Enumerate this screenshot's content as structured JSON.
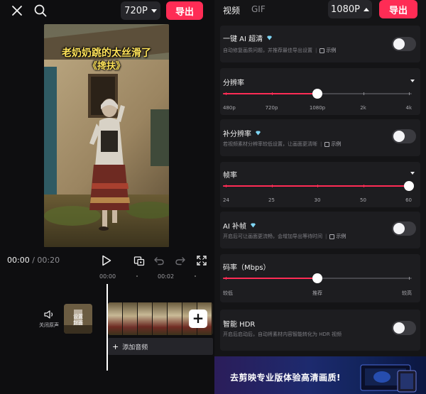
{
  "editor": {
    "resolution_pill": "720P",
    "export_label": "导出",
    "caption_line1": "老奶奶跳的太丝滑了",
    "caption_line2": "《搀扶》",
    "time_current": "00:00",
    "time_separator": " / ",
    "time_total": "00:20",
    "ruler_labels": [
      "00:00",
      "00:02"
    ],
    "track_mute_label": "关闭原声",
    "cover_label_line1": "设置",
    "cover_label_line2": "封面",
    "add_audio_label": "添加音频"
  },
  "export_panel": {
    "tabs": [
      {
        "label": "视频",
        "active": true
      },
      {
        "label": "GIF",
        "active": false
      }
    ],
    "resolution_pill": "1080P",
    "export_label": "导出",
    "example_label": "示例",
    "one_key_hd": {
      "title": "一键 AI 超清",
      "desc": "自动修复画质问题，并推荐最佳导出设置",
      "enabled": false
    },
    "resolution": {
      "title": "分辨率",
      "ticks": [
        "480p",
        "720p",
        "1080p",
        "2k",
        "4k"
      ],
      "selected_index": 2
    },
    "upscale": {
      "title": "补分辨率",
      "desc": "若视频素材分辨率较低设置，让画面更清晰",
      "enabled": false
    },
    "frame_rate": {
      "title": "帧率",
      "ticks": [
        "24",
        "25",
        "30",
        "50",
        "60"
      ],
      "selected_index": 4
    },
    "ai_interp": {
      "title": "AI 补帧",
      "desc": "开启后可让画面更流畅，会增加导出等待时间",
      "enabled": false
    },
    "bitrate": {
      "title": "码率（Mbps）",
      "ticks": [
        "较低",
        "推荐",
        "较高"
      ],
      "selected_index": 1
    },
    "hdr": {
      "title": "智能 HDR",
      "desc": "开启后启动后，自动将素材内容智能转化为 HDR 视频",
      "enabled": false
    },
    "banner_text": "去剪映专业版体验高清画质!"
  },
  "colors": {
    "accent": "#fe2c55",
    "caption": "#ffe35a",
    "gem": "#7fd6f5"
  }
}
